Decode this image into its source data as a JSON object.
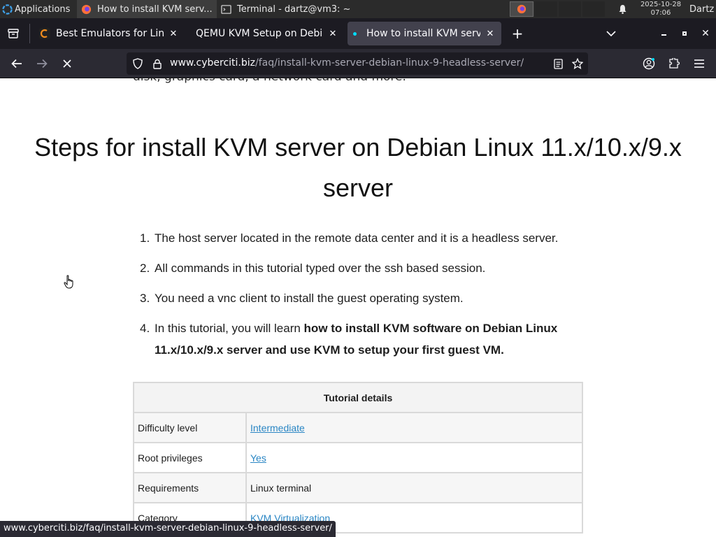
{
  "panel": {
    "applications_label": "Applications",
    "tasks": [
      {
        "label": "How to install KVM serv..."
      },
      {
        "label": "Terminal - dartz@vm3: ~"
      }
    ],
    "clock_date": "2025-10-28",
    "clock_time": "07:06",
    "user": "Dartz"
  },
  "browser": {
    "tabs": [
      {
        "label": "Best Emulators for Linux",
        "selected": false
      },
      {
        "label": "QEMU KVM Setup on Debian",
        "selected": false
      },
      {
        "label": "How to install KVM server",
        "selected": true
      }
    ],
    "url_host": "www.cyberciti.biz",
    "url_path": "/faq/install-kvm-server-debian-linux-9-headless-server/",
    "status_url": "www.cyberciti.biz/faq/install-kvm-server-debian-linux-9-headless-server/"
  },
  "article": {
    "clipped_text": "disk, graphics card, a network card and more.",
    "heading": "Steps for install KVM server on Debian Linux 11.x/10.x/9.x server",
    "steps": [
      {
        "num": "1.",
        "text": "The host server located in the remote data center and it is a headless server.",
        "bold": ""
      },
      {
        "num": "2.",
        "text": "All commands in this tutorial typed over the ssh based session.",
        "bold": ""
      },
      {
        "num": "3.",
        "text": "You need a vnc client to install the guest operating system.",
        "bold": ""
      },
      {
        "num": "4.",
        "text": "In this tutorial, you will learn ",
        "bold": "how to install KVM software on Debian Linux 11.x/10.x/9.x server and use KVM to setup your first guest VM."
      }
    ],
    "table": {
      "header": "Tutorial details",
      "rows": [
        {
          "label": "Difficulty level",
          "value": "Intermediate",
          "link": true
        },
        {
          "label": "Root privileges",
          "value": "Yes",
          "link": true
        },
        {
          "label": "Requirements",
          "value": "Linux terminal",
          "link": false
        },
        {
          "label": "Category",
          "value": "KVM Virtualization",
          "link": true
        }
      ]
    }
  },
  "colors": {
    "link": "#2a86c4",
    "tab_selected": "#42414d",
    "toolbar": "#2b2a33"
  }
}
